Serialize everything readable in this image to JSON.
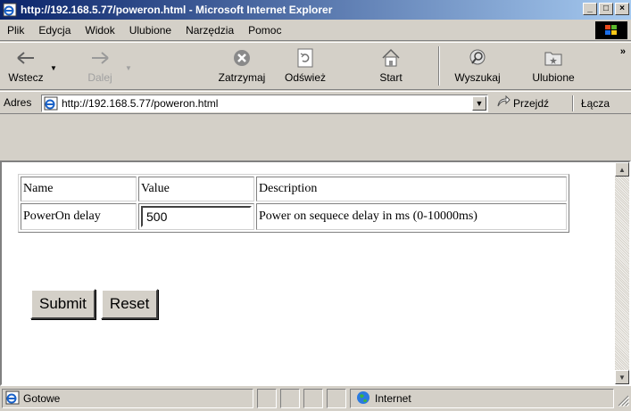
{
  "window": {
    "title": "http://192.168.5.77/poweron.html - Microsoft Internet Explorer",
    "minimize_glyph": "_",
    "maximize_glyph": "□",
    "close_glyph": "×",
    "app_icon": "ie-page-icon"
  },
  "menu": {
    "items": [
      {
        "label": "Plik",
        "accel": "P"
      },
      {
        "label": "Edycja",
        "accel": "E"
      },
      {
        "label": "Widok",
        "accel": "W"
      },
      {
        "label": "Ulubione",
        "accel": "U"
      },
      {
        "label": "Narzędzia",
        "accel": "N"
      },
      {
        "label": "Pomoc",
        "accel": "c"
      }
    ],
    "logo_icon": "windows-logo-icon"
  },
  "toolbar": {
    "back": {
      "label": "Wstecz",
      "icon": "back-arrow-icon"
    },
    "forward": {
      "label": "Dalej",
      "icon": "forward-arrow-icon",
      "disabled": true
    },
    "stop": {
      "label": "Zatrzymaj",
      "icon": "stop-icon"
    },
    "refresh": {
      "label": "Odśwież",
      "icon": "refresh-icon"
    },
    "home": {
      "label": "Start",
      "icon": "home-icon"
    },
    "search": {
      "label": "Wyszukaj",
      "icon": "search-icon"
    },
    "favorites": {
      "label": "Ulubione",
      "icon": "favorites-icon"
    },
    "more_glyph": "»"
  },
  "address": {
    "label": "Adres",
    "url": "http://192.168.5.77/poweron.html",
    "go_label": "Przejdź",
    "links_label": "Łącza"
  },
  "page": {
    "table": {
      "headers": [
        "Name",
        "Value",
        "Description"
      ],
      "rows": [
        {
          "name": "PowerOn delay",
          "value": "500",
          "description": "Power on sequece delay in ms (0-10000ms)"
        }
      ]
    },
    "submit_label": "Submit",
    "reset_label": "Reset"
  },
  "status": {
    "text": "Gotowe",
    "zone": "Internet"
  },
  "colors": {
    "titlebar_start": "#0a246a",
    "titlebar_end": "#a6caf0",
    "chrome": "#d4d0c8"
  }
}
